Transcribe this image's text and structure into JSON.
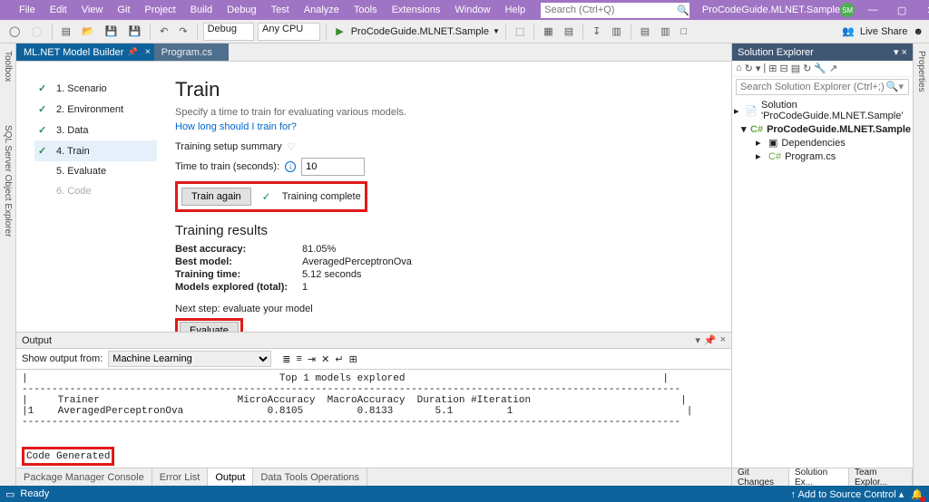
{
  "menubar": [
    "File",
    "Edit",
    "View",
    "Git",
    "Project",
    "Build",
    "Debug",
    "Test",
    "Analyze",
    "Tools",
    "Extensions",
    "Window",
    "Help"
  ],
  "titlebar": {
    "search_placeholder": "Search (Ctrl+Q)",
    "solution_name": "ProCodeGuide.MLNET.Sample",
    "user_initials": "SM",
    "live_share": "Live Share"
  },
  "toolbar": {
    "config": "Debug",
    "platform": "Any CPU",
    "start_target": "ProCodeGuide.MLNET.Sample"
  },
  "doc_tabs": [
    {
      "label": "ML.NET Model Builder",
      "active": true
    },
    {
      "label": "Program.cs",
      "active": false
    }
  ],
  "mb": {
    "steps": [
      {
        "n": "1",
        "label": "Scenario",
        "done": true
      },
      {
        "n": "2",
        "label": "Environment",
        "done": true
      },
      {
        "n": "3",
        "label": "Data",
        "done": true
      },
      {
        "n": "4",
        "label": "Train",
        "done": true,
        "active": true
      },
      {
        "n": "5",
        "label": "Evaluate",
        "done": false
      },
      {
        "n": "6",
        "label": "Code",
        "done": false,
        "disabled": true
      }
    ],
    "title": "Train",
    "subtitle": "Specify a time to train for evaluating various models.",
    "help_link": "How long should I train for?",
    "setup_summary": "Training setup summary",
    "time_label": "Time to train (seconds):",
    "time_value": "10",
    "train_again_btn": "Train again",
    "train_status": "Training complete",
    "results_heading": "Training results",
    "results": [
      {
        "k": "Best accuracy:",
        "v": "81.05%"
      },
      {
        "k": "Best model:",
        "v": "AveragedPerceptronOva"
      },
      {
        "k": "Training time:",
        "v": "5.12 seconds"
      },
      {
        "k": "Models explored (total):",
        "v": "1"
      }
    ],
    "next_step": "Next step: evaluate your model",
    "evaluate_btn": "Evaluate"
  },
  "output": {
    "title": "Output",
    "from_label": "Show output from:",
    "from_value": "Machine Learning",
    "text": "|                                          Top 1 models explored                                           |\n--------------------------------------------------------------------------------------------------------------\n|     Trainer                       MicroAccuracy  MacroAccuracy  Duration #Iteration                         |\n|1    AveragedPerceptronOva              0.8105         0.8133       5.1         1                             |\n--------------------------------------------------------------------------------------------------------------",
    "code_generated": "Code Generated"
  },
  "bottom_tabs": [
    "Package Manager Console",
    "Error List",
    "Output",
    "Data Tools Operations"
  ],
  "solution": {
    "title": "Solution Explorer",
    "search_placeholder": "Search Solution Explorer (Ctrl+;)",
    "root": "Solution 'ProCodeGuide.MLNET.Sample'",
    "project": "ProCodeGuide.MLNET.Sample",
    "deps": "Dependencies",
    "program": "Program.cs",
    "btabs": [
      "Git Changes",
      "Solution Ex...",
      "Team Explor..."
    ]
  },
  "side_left": [
    "Toolbox",
    "SQL Server Object Explorer"
  ],
  "side_right": [
    "Properties"
  ],
  "status": {
    "ready": "Ready",
    "source_control": "Add to Source Control"
  }
}
